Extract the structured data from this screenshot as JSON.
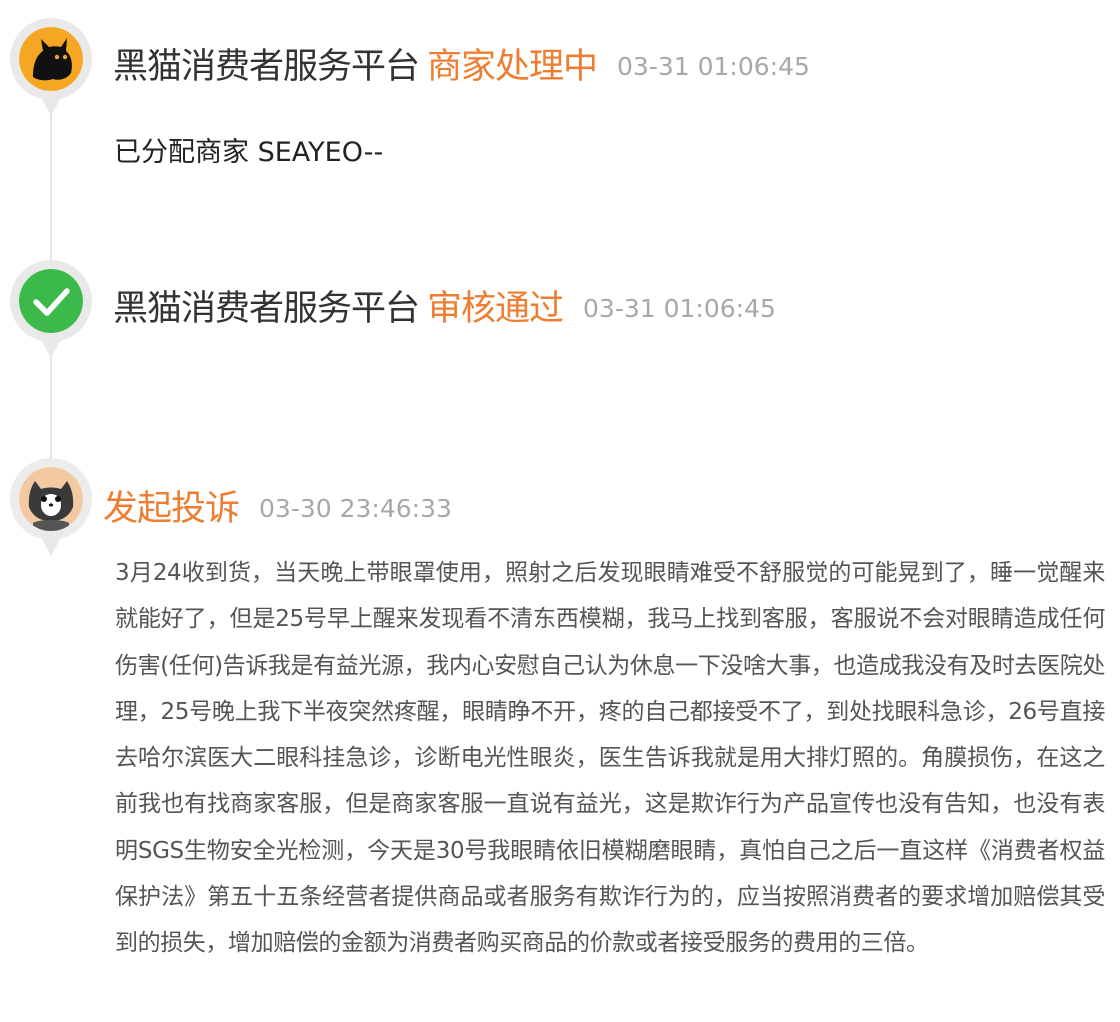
{
  "timeline": [
    {
      "avatar_icon": "black-cat-logo-icon",
      "platform": "黑猫消费者服务平台",
      "status": "商家处理中",
      "time": "03-31 01:06:45",
      "detail": "已分配商家 SEAYEO--"
    },
    {
      "avatar_icon": "check-circle-icon",
      "platform": "黑猫消费者服务平台",
      "status": "审核通过",
      "time": "03-31 01:06:45"
    },
    {
      "avatar_icon": "cat-user-avatar-icon",
      "status": "发起投诉",
      "time": "03-30 23:46:33",
      "content": "3月24收到货，当天晚上带眼罩使用，照射之后发现眼睛难受不舒服觉的可能晃到了，睡一觉醒来就能好了，但是25号早上醒来发现看不清东西模糊，我马上找到客服，客服说不会对眼睛造成任何伤害(任何)告诉我是有益光源，我内心安慰自己认为休息一下没啥大事，也造成我没有及时去医院处理，25号晚上我下半夜突然疼醒，眼睛睁不开，疼的自己都接受不了，到处找眼科急诊，26号直接去哈尔滨医大二眼科挂急诊，诊断电光性眼炎，医生告诉我就是用大排灯照的。角膜损伤，在这之前我也有找商家客服，但是商家客服一直说有益光，这是欺诈行为产品宣传也没有告知，也没有表明SGS生物安全光检测，今天是30号我眼睛依旧模糊磨眼睛，真怕自己之后一直这样《消费者权益保护法》第五十五条经营者提供商品或者服务有欺诈行为的，应当按照消费者的要求增加赔偿其受到的损失，增加赔偿的金额为消费者购买商品的价款或者接受服务的费用的三倍。"
    }
  ],
  "colors": {
    "status_orange": "#ef7d31",
    "check_green": "#3cb94b",
    "logo_orange": "#f5a623"
  }
}
